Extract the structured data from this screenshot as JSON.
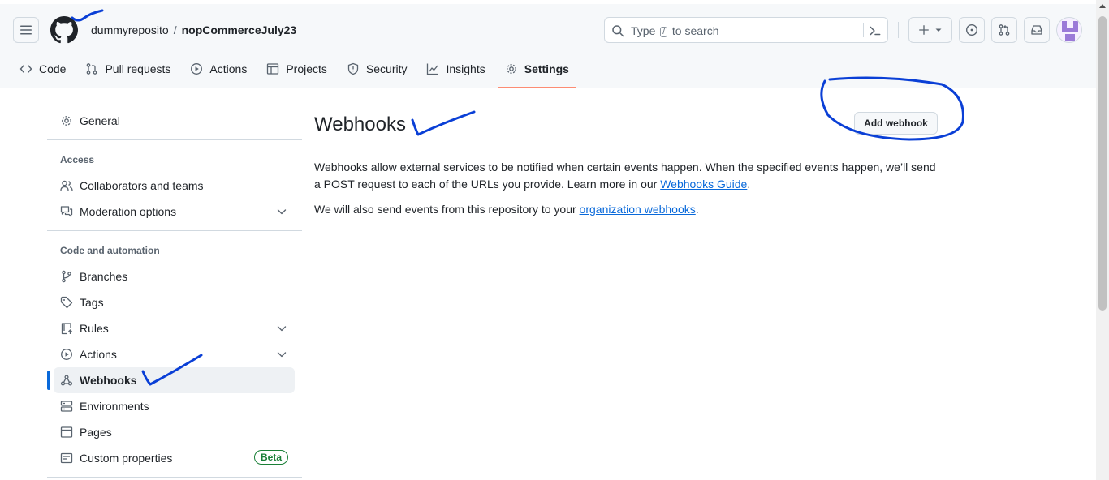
{
  "header": {
    "owner": "dummyreposito",
    "separator": "/",
    "repo": "nopCommerceJuly23",
    "search": {
      "prefix": "Type",
      "key": "/",
      "suffix": "to search"
    },
    "icons": [
      "hamburger-icon",
      "github-logo",
      "search-icon",
      "command-palette-icon",
      "plus-icon",
      "triangle-down-icon",
      "issue-icon",
      "pull-request-icon",
      "inbox-icon",
      "avatar"
    ]
  },
  "tabs": [
    {
      "label": "Code",
      "icon": "code-icon"
    },
    {
      "label": "Pull requests",
      "icon": "pull-request-icon"
    },
    {
      "label": "Actions",
      "icon": "play-icon"
    },
    {
      "label": "Projects",
      "icon": "table-icon"
    },
    {
      "label": "Security",
      "icon": "shield-icon"
    },
    {
      "label": "Insights",
      "icon": "graph-icon"
    },
    {
      "label": "Settings",
      "icon": "gear-icon",
      "selected": true
    }
  ],
  "sidebar": {
    "general": "General",
    "access_heading": "Access",
    "collaborators": "Collaborators and teams",
    "moderation": "Moderation options",
    "code_heading": "Code and automation",
    "branches": "Branches",
    "tags": "Tags",
    "rules": "Rules",
    "actions": "Actions",
    "webhooks": "Webhooks",
    "environments": "Environments",
    "pages": "Pages",
    "custom_properties": "Custom properties",
    "beta": "Beta"
  },
  "main": {
    "title": "Webhooks",
    "add_button": "Add webhook",
    "p1_text": "Webhooks allow external services to be notified when certain events happen. When the specified events happen, we’ll send a POST request to each of the URLs you provide. Learn more in our ",
    "p1_link": "Webhooks Guide",
    "p1_end": ".",
    "p2_text": "We will also send events from this repository to your ",
    "p2_link": "organization webhooks",
    "p2_end": "."
  },
  "colors": {
    "accent_link": "#0969da",
    "selected_tab_underline": "#fd8c73",
    "active_nav_bar": "#0969da",
    "beta_green": "#1a7f37",
    "annotation_ink": "#0a3fd6"
  }
}
